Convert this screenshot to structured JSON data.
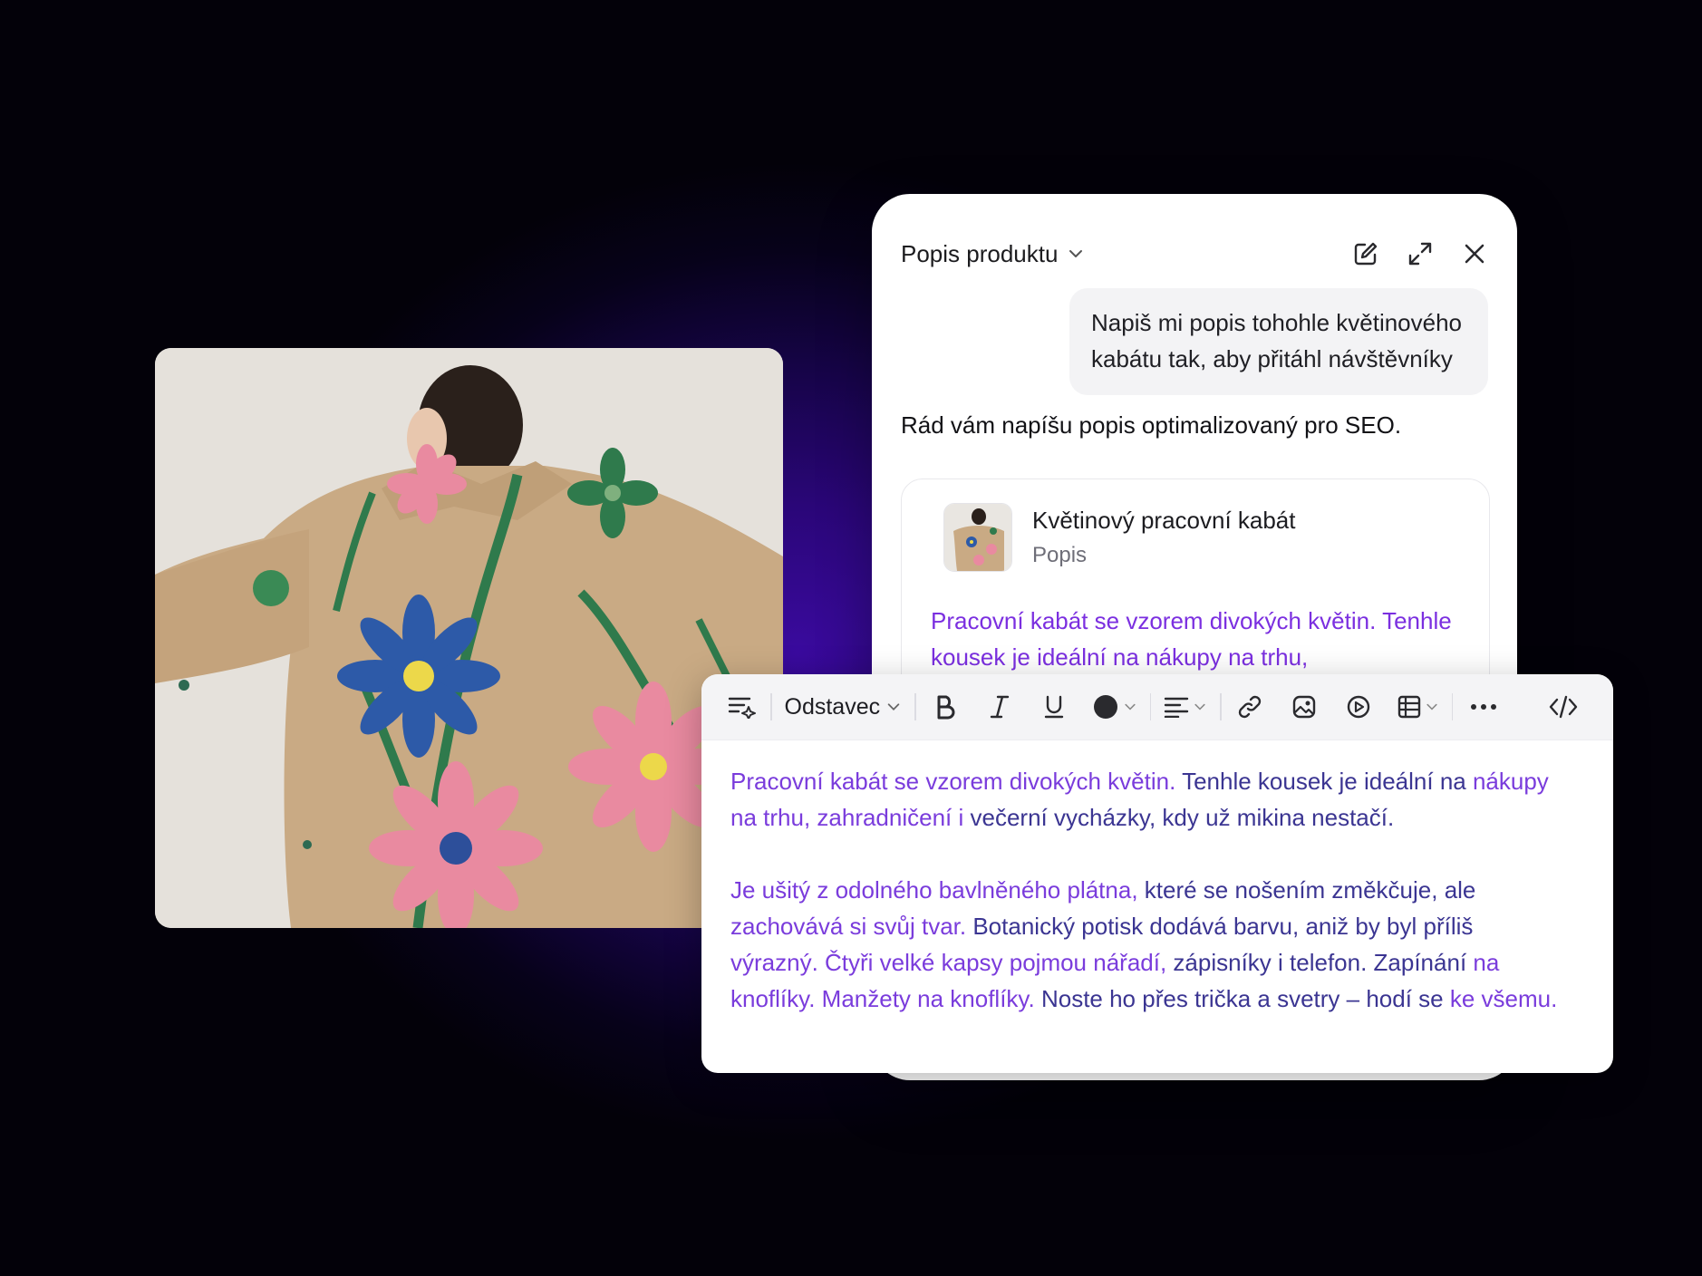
{
  "chat": {
    "title": "Popis produktu",
    "icons": [
      "edit-icon",
      "expand-icon",
      "close-icon"
    ],
    "user_message": "Napiš mi popis tohohle květinového kabátu tak, aby přitáhl návštěvníky",
    "assistant_message": "Rád vám napíšu popis optimalizovaný pro SEO.",
    "card": {
      "title": "Květinový pracovní kabát",
      "subtitle": "Popis",
      "text": "Pracovní kabát se vzorem divokých květin. Tenhle kousek je ideální na nákupy na trhu,"
    }
  },
  "editor": {
    "toolbar": {
      "paragraph_label": "Odstavec",
      "icons": [
        "ai-format-icon",
        "bold-icon",
        "italic-icon",
        "underline-icon",
        "text-color-icon",
        "align-icon",
        "link-icon",
        "image-icon",
        "video-icon",
        "table-icon",
        "more-icon",
        "code-icon"
      ]
    },
    "paragraph1_a": "Pracovní kabát se vzorem divokých květin. ",
    "paragraph1_b": "Tenhle kousek je ideální na ",
    "paragraph1_c": "nákupy na trhu, zahradničení i ",
    "paragraph1_d": "večerní vycházky, kdy už mikina nestačí.",
    "paragraph2_a": "Je ušitý z odolného bavlněného plátna, ",
    "paragraph2_b": "které se nošením změkčuje, ale ",
    "paragraph2_c": "zachovává si svůj tvar. ",
    "paragraph2_d": "Botanický potisk dodává barvu, aniž by byl příliš ",
    "paragraph2_e": "výrazný. Čtyři velké kapsy pojmou nářadí, ",
    "paragraph2_f": "zápisníky i telefon. Zapínání ",
    "paragraph2_g": "na knoflíky. Manžety na knoflíky. ",
    "paragraph2_h": "Noste ho přes trička a svetry – hodí se ",
    "paragraph2_i": "ke všemu."
  },
  "colors": {
    "accent_purple": "#7a3cdc",
    "text_indigo": "#3b3592",
    "background": "#160447"
  }
}
